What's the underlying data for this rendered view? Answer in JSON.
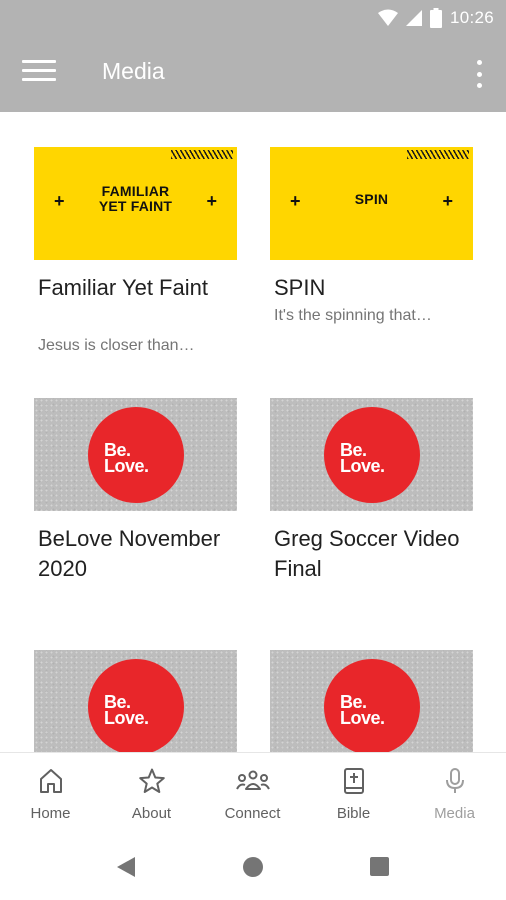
{
  "status_bar": {
    "time": "10:26"
  },
  "app_bar": {
    "title": "Media"
  },
  "media_items": [
    {
      "thumb_type": "yellow",
      "thumb_text_1": "FAMILIAR",
      "thumb_text_2": "YET FAINT",
      "title": "Familiar Yet Faint",
      "subtitle": "Jesus is closer than…"
    },
    {
      "thumb_type": "yellow",
      "thumb_text_1": "SPIN",
      "title": "SPIN",
      "subtitle": "It's the spinning that…"
    },
    {
      "thumb_type": "belove",
      "logo_1": "Be.",
      "logo_2": "Love.",
      "title": "BeLove November 2020"
    },
    {
      "thumb_type": "belove",
      "logo_1": "Be.",
      "logo_2": "Love.",
      "title": "Greg Soccer Video Final"
    },
    {
      "thumb_type": "belove",
      "logo_1": "Be.",
      "logo_2": "Love."
    },
    {
      "thumb_type": "belove",
      "logo_1": "Be.",
      "logo_2": "Love."
    }
  ],
  "bottom_nav": [
    {
      "label": "Home",
      "icon": "home-icon"
    },
    {
      "label": "About",
      "icon": "star-icon"
    },
    {
      "label": "Connect",
      "icon": "people-icon"
    },
    {
      "label": "Bible",
      "icon": "bible-icon"
    },
    {
      "label": "Media",
      "icon": "mic-icon",
      "active": true
    }
  ],
  "colors": {
    "app_bar": "#b3b3b3",
    "yellow": "#ffd600",
    "brand_red": "#e8262a"
  }
}
